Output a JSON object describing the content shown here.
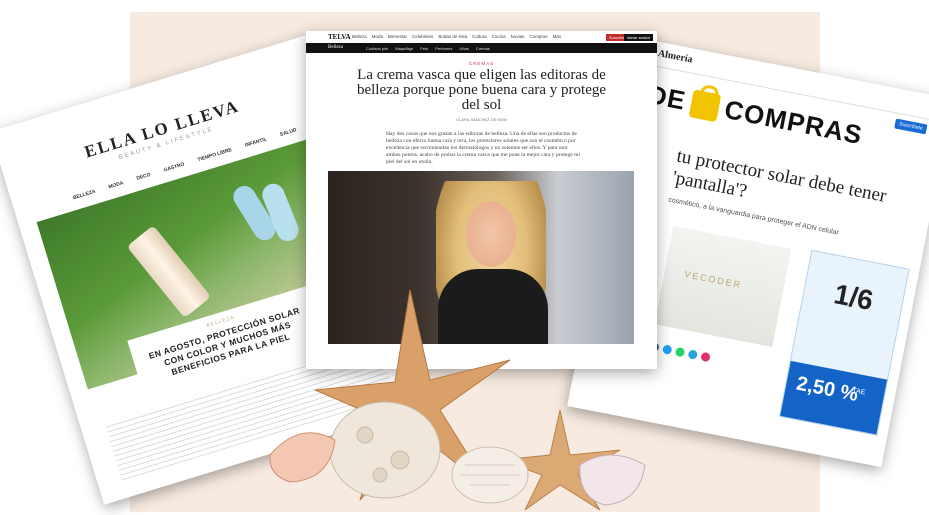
{
  "left_article": {
    "brand": "ELLA LO LLEVA",
    "tagline": "BEAUTY & LIFESTYLE",
    "nav": [
      "BELLEZA",
      "MODA",
      "DECO",
      "GASTRO",
      "TIEMPO LIBRE",
      "INFANTIL",
      "SALUD"
    ],
    "kicker": "BELLEZA",
    "title": "EN AGOSTO, PROTECCIÓN SOLAR CON COLOR Y MUCHOS MÁS BENEFICIOS PARA LA PIEL"
  },
  "center_article": {
    "logo": "TELVA",
    "top_nav": [
      "Belleza",
      "Moda",
      "Bienestar",
      "Celebrities",
      "Bodas de ésta",
      "Cultura",
      "Cocina",
      "Novias",
      "Compras",
      "Más"
    ],
    "subscribe": "Suscríbete",
    "login": "Iniciar sesión",
    "section": "Belleza",
    "section_nav": [
      "Cuidado piel",
      "Maquillaje",
      "Pelo",
      "Perfumes",
      "Uñas",
      "Cremas"
    ],
    "kicker": "CREMAS",
    "title": "La crema vasca que eligen las editoras de belleza porque pone buena cara y protege del sol",
    "byline": "CLARA SÁNCHEZ DE MON",
    "lead": "Hay dos cosas que nos gustan a las editoras de belleza. Una de ellas son productos de belleza con efecto buena cara y otra, los protectores solares que son el cosmético por excelencia que recomiendan los dermatólogos y no solemos ser ellos. Y para unir ambos puntos, acabo de probar la crema vasca que me pone la mejor cara y protege mi piel del sol en otoño."
  },
  "right_article": {
    "paper": "de Almería",
    "section": "DE COMPRAS",
    "button": "Suscríbete",
    "title": "tu protector solar debe tener 'pantalla'?",
    "lead": "cosmético, a la vanguardia para proteger el ADN celular",
    "ad_ratio": "1/6",
    "ad_rate": "2,50 %",
    "ad_tae": "TAE"
  },
  "colors": {
    "background_panel": "#f7ebe1",
    "accent_pink": "#c42b6e",
    "ad_blue": "#1464c8",
    "bag_yellow": "#f2c300"
  }
}
